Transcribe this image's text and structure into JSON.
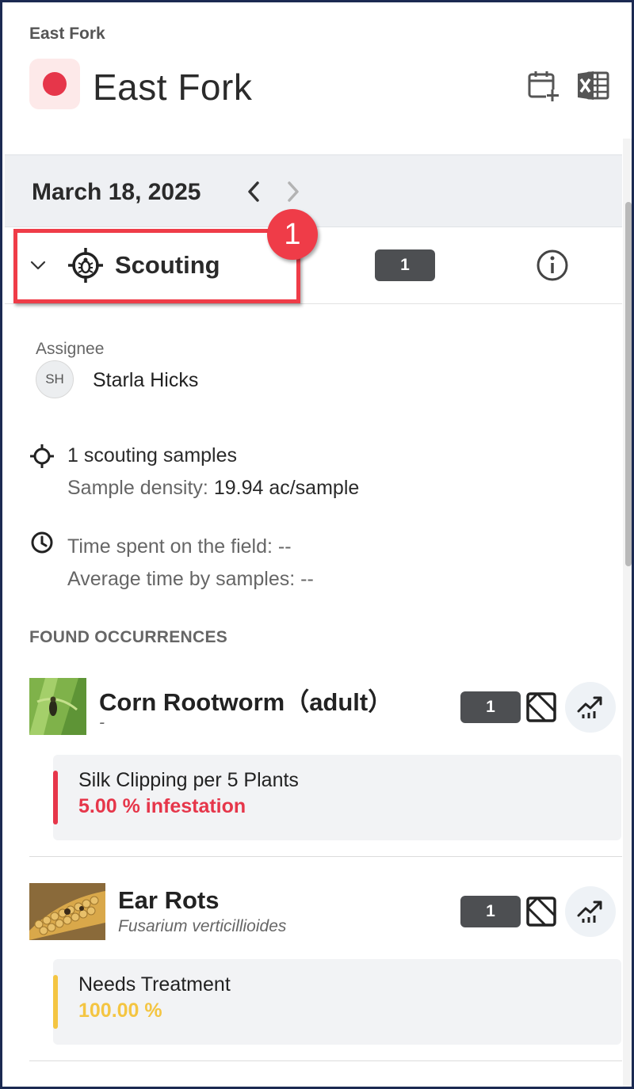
{
  "header": {
    "breadcrumb": "East Fork",
    "title": "East Fork",
    "field_color": "#e6364a",
    "icons": [
      "calendar-add-icon",
      "excel-export-icon"
    ]
  },
  "date_nav": {
    "date": "March 18, 2025",
    "prev_icon": "chevron-left-icon",
    "next_icon": "chevron-right-icon"
  },
  "scouting": {
    "label": "Scouting",
    "count": "1",
    "step_marker": "1",
    "highlight_color": "#ef3c48"
  },
  "assignee": {
    "label": "Assignee",
    "initials": "SH",
    "name": "Starla Hicks"
  },
  "samples": {
    "count_text": "1 scouting samples",
    "density_label": "Sample density:",
    "density_value": "19.94 ac/sample"
  },
  "time": {
    "field_text": "Time spent on the field: --",
    "average_text": "Average time by samples: --"
  },
  "occurrences": {
    "title": "FOUND OCCURRENCES",
    "items": [
      {
        "name": "Corn Rootworm（adult）",
        "subtitle": "-",
        "count": "1",
        "metric_label": "Silk Clipping per 5 Plants",
        "metric_value": "5.00 % infestation",
        "metric_color": "#e6364a"
      },
      {
        "name": "Ear Rots",
        "subtitle": "Fusarium verticillioides",
        "count": "1",
        "metric_label": "Needs Treatment",
        "metric_value": "100.00 %",
        "metric_color": "#f4c542"
      }
    ]
  }
}
